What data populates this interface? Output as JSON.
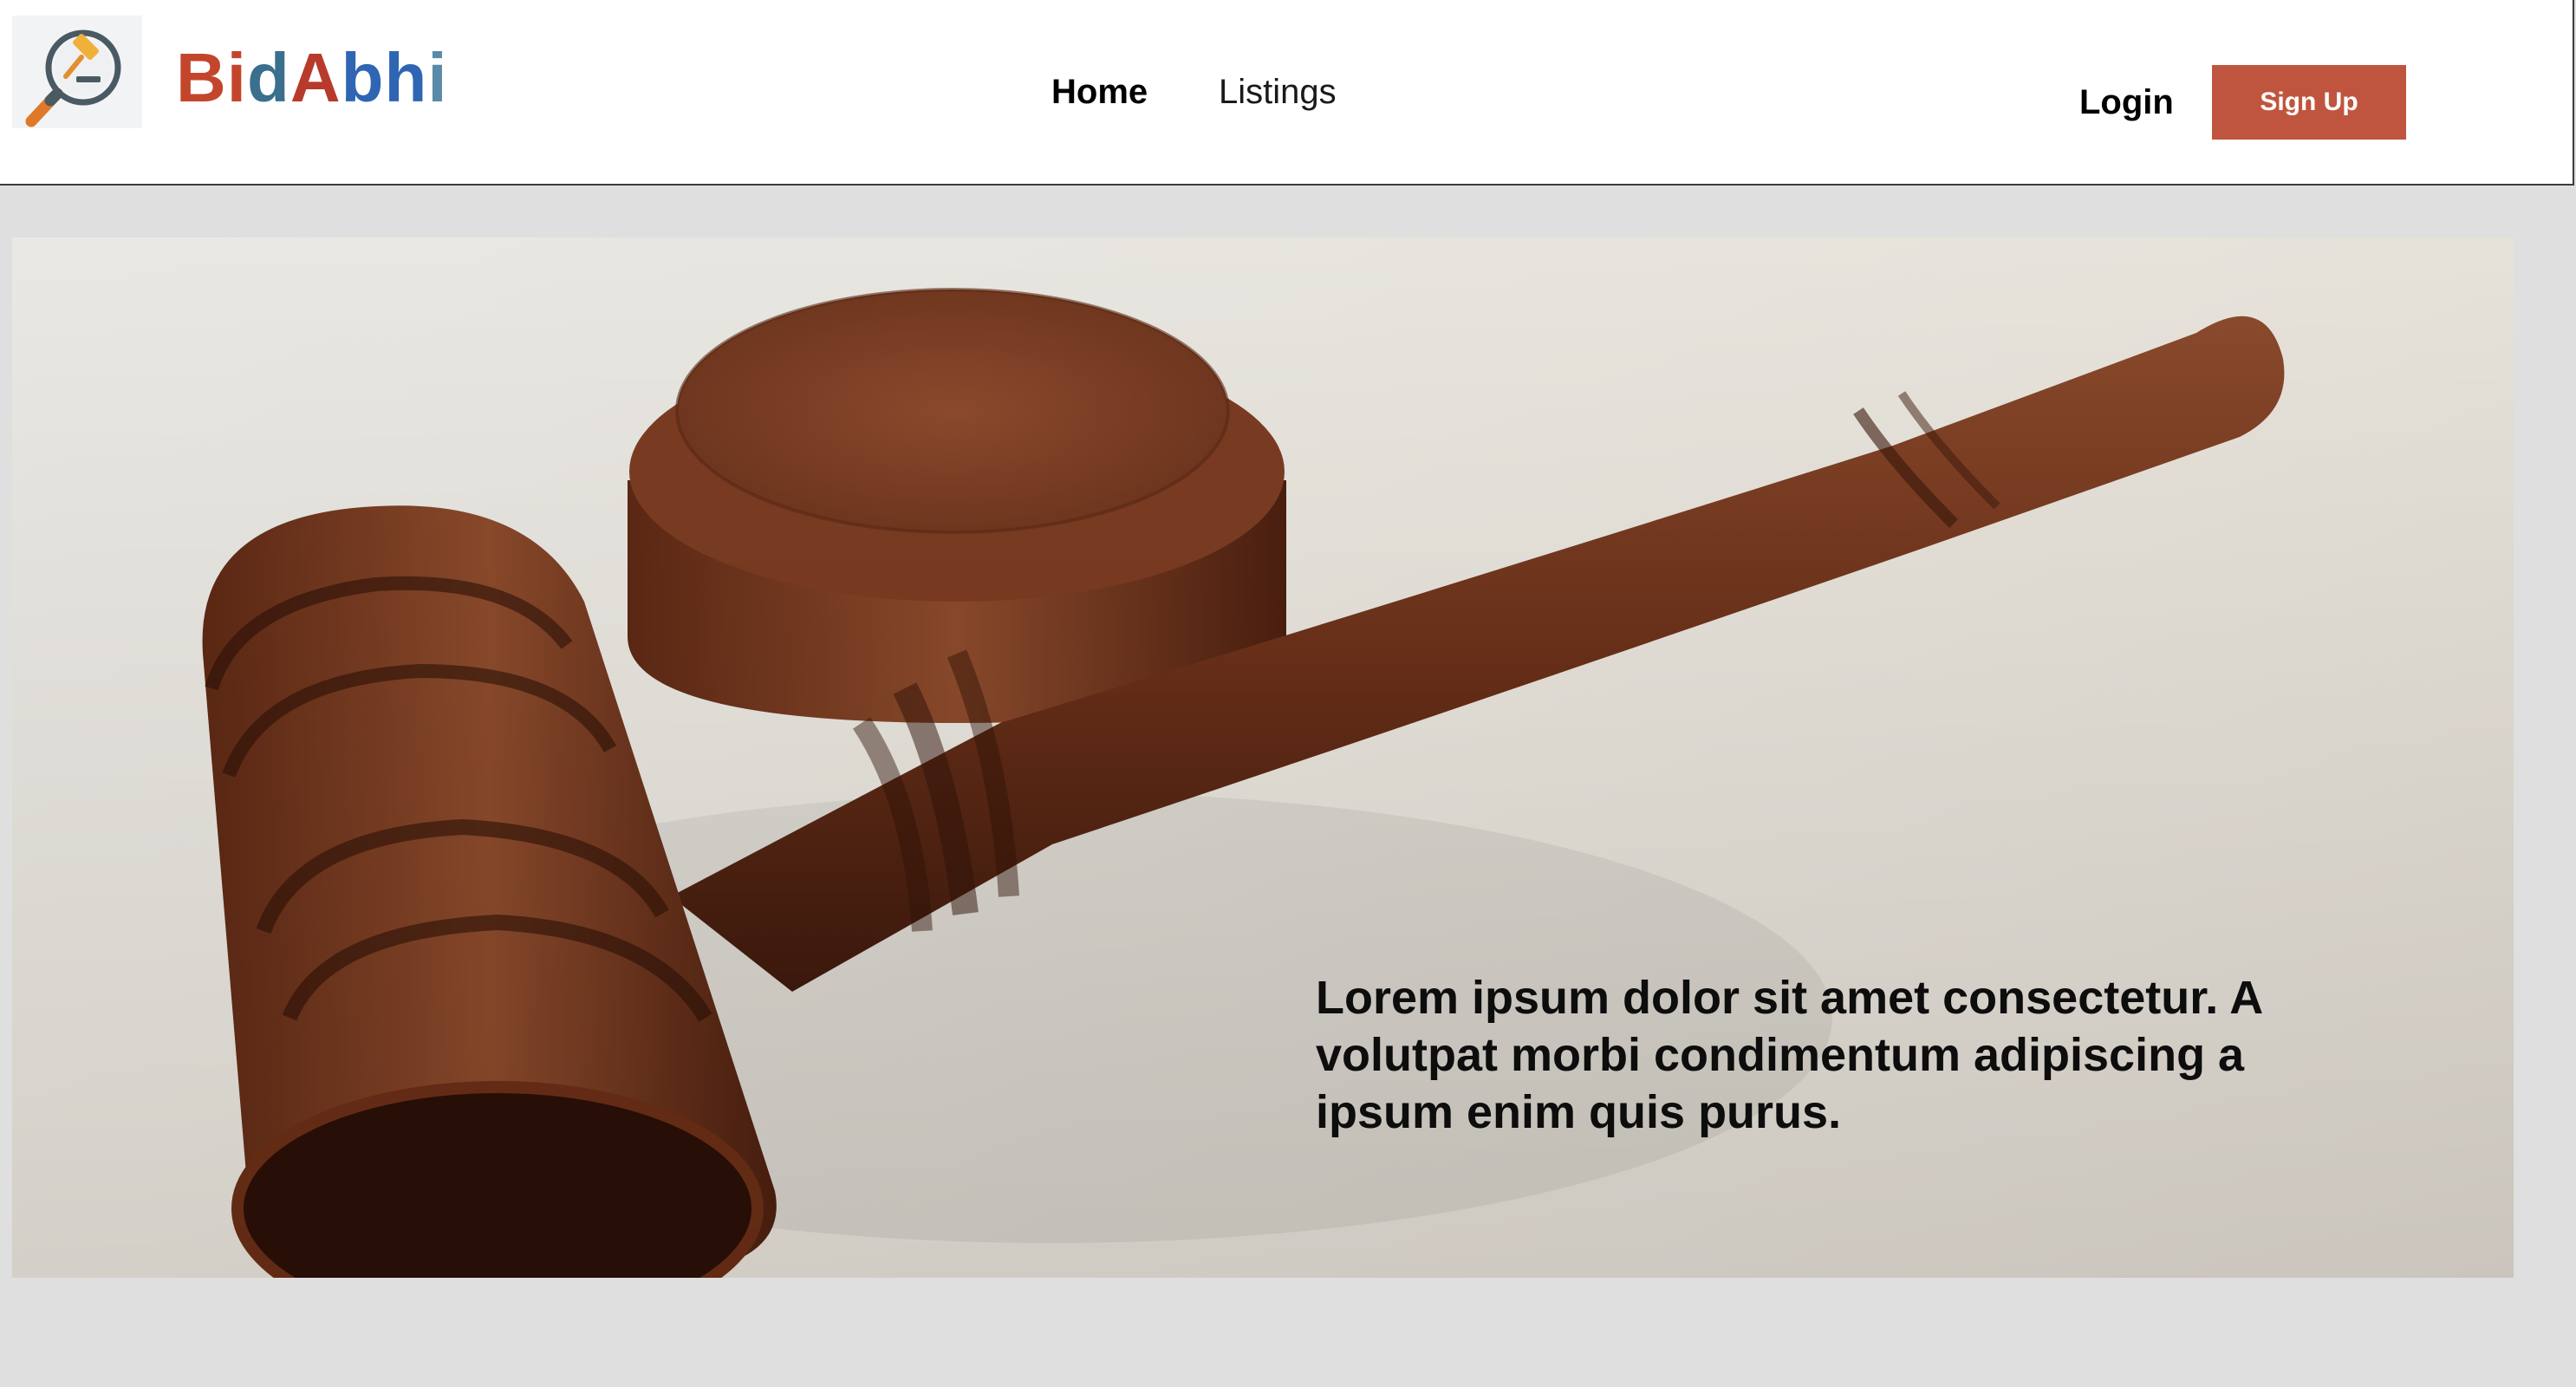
{
  "brand": {
    "name_parts": [
      "B",
      "i",
      "d",
      "A",
      "b",
      "h",
      "i"
    ],
    "colors": [
      "#c3462c",
      "#c3462c",
      "#3a6f8e",
      "#b83a2a",
      "#2f66b3",
      "#2f66b3",
      "#5a8aa8"
    ],
    "logo_icon": "gavel-magnifier-icon"
  },
  "nav": {
    "items": [
      {
        "label": "Home",
        "active": true
      },
      {
        "label": "Listings",
        "active": false
      }
    ]
  },
  "auth": {
    "login_label": "Login",
    "signup_label": "Sign Up",
    "signup_color": "#c0553f"
  },
  "hero": {
    "image": "wooden-gavel-photo",
    "text": "Lorem ipsum dolor sit amet consectetur. A volutpat morbi condimentum adipiscing a ipsum enim quis purus."
  }
}
